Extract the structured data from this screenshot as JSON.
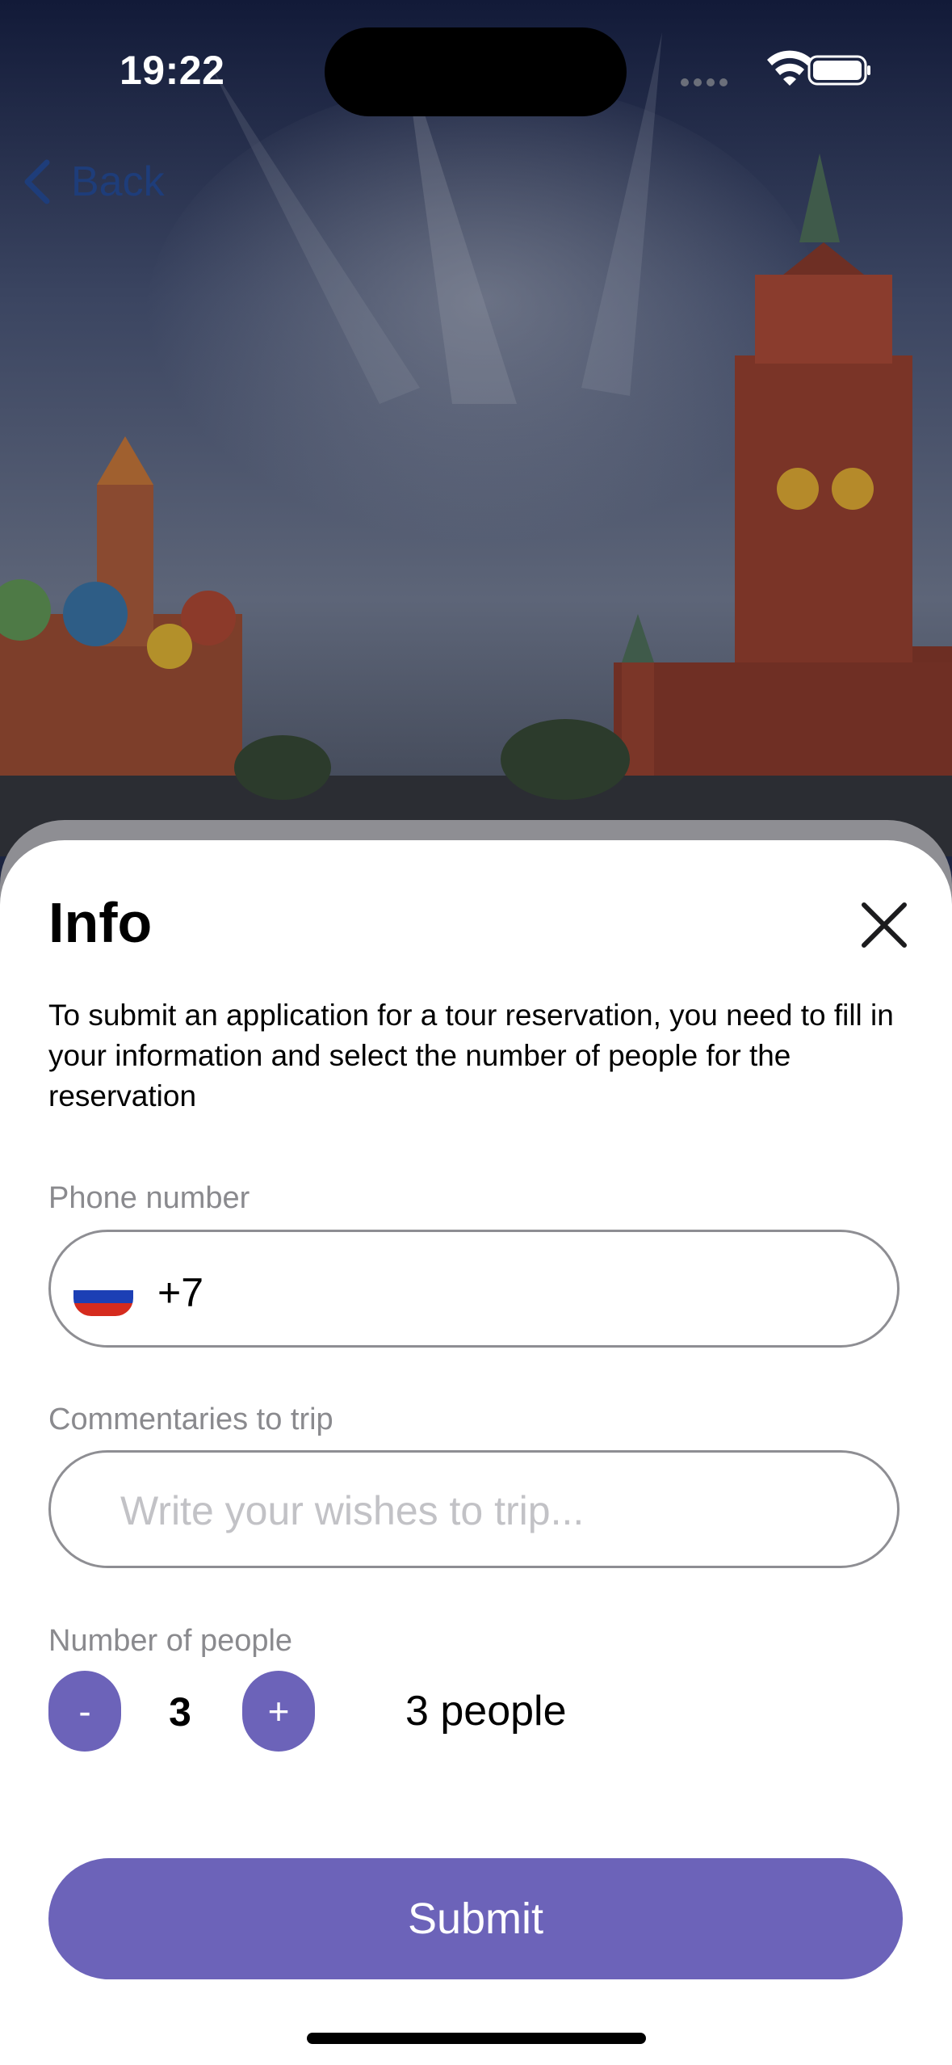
{
  "status_bar": {
    "time": "19:22",
    "icons": [
      "signal-dots-icon",
      "wifi-icon",
      "battery-icon"
    ]
  },
  "nav": {
    "back_label": "Back",
    "back_icon": "chevron-left-icon"
  },
  "hero_image": {
    "icon": "red-square-moscow-photo"
  },
  "sheet": {
    "title": "Info",
    "close_icon": "close-icon",
    "description": "To submit an application for a tour reservation, you need to fill in your information and select the number of people for the reservation",
    "phone": {
      "label": "Phone number",
      "flag_icon": "russia-flag-icon",
      "value": "+7"
    },
    "comment": {
      "label": "Commentaries to trip",
      "value": "",
      "placeholder": "Write your wishes to trip..."
    },
    "people": {
      "label": "Number of people",
      "decrement_label": "-",
      "count": "3",
      "increment_label": "+",
      "summary": "3 people"
    },
    "submit_label": "Submit"
  },
  "colors": {
    "accent": "#6c63b9",
    "back_link": "#1e3d7a",
    "label_gray": "#8a8a8e",
    "border_gray": "#8e8e93"
  }
}
